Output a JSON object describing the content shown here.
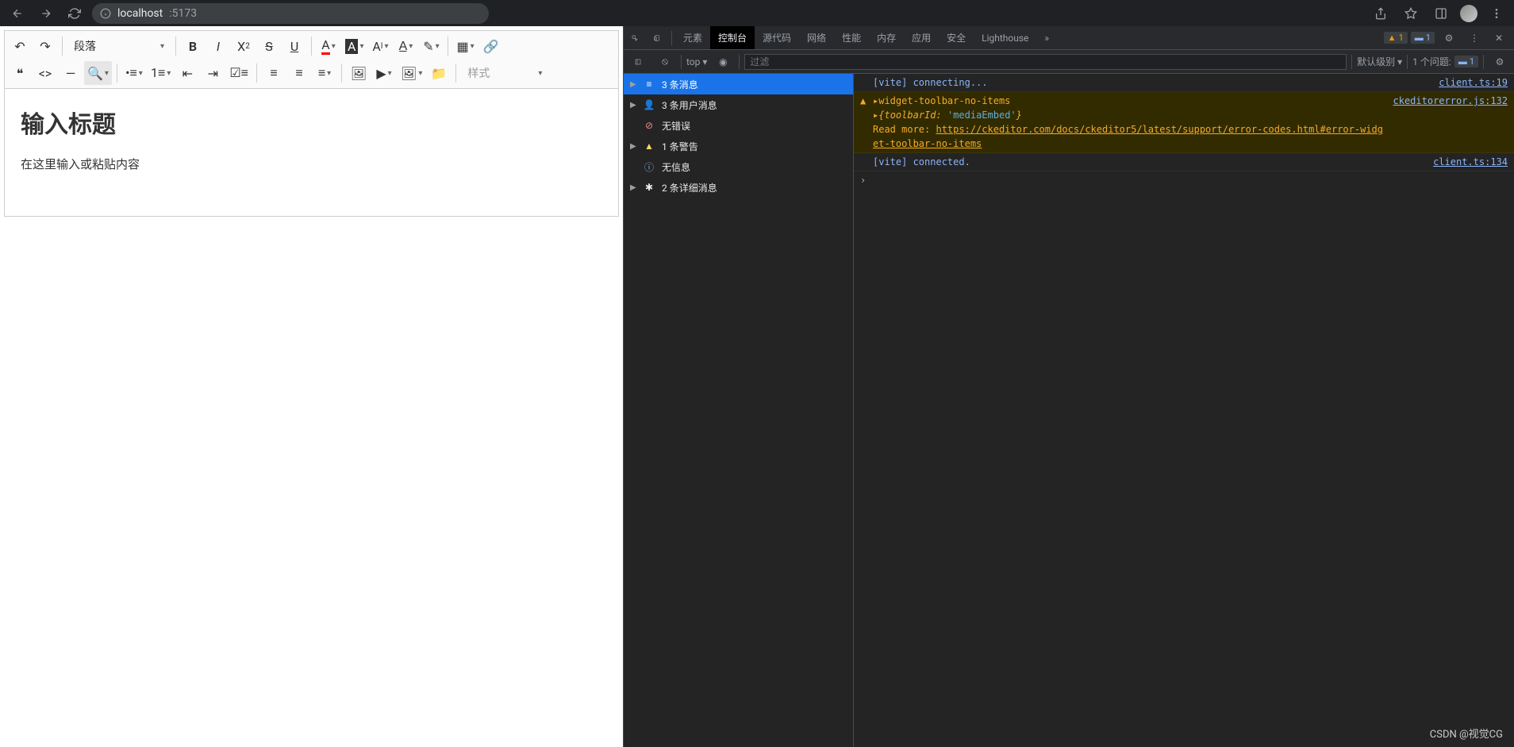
{
  "browser": {
    "url_host": "localhost",
    "url_port": ":5173"
  },
  "editor": {
    "heading_label": "段落",
    "style_label": "样式",
    "title_placeholder": "输入标题",
    "body_placeholder": "在这里输入或粘贴内容"
  },
  "devtools": {
    "tabs": {
      "elements": "元素",
      "console": "控制台",
      "sources": "源代码",
      "network": "网络",
      "performance": "性能",
      "memory": "内存",
      "application": "应用",
      "security": "安全",
      "lighthouse": "Lighthouse"
    },
    "badge_warn": "1",
    "badge_info": "1",
    "filter": {
      "context": "top",
      "placeholder": "过滤",
      "level": "默认级别",
      "issues_label": "1 个问题:",
      "issues_count": "1"
    },
    "sidebar": {
      "messages": "3 条消息",
      "user_messages": "3 条用户消息",
      "no_errors": "无错误",
      "warnings": "1 条警告",
      "no_info": "无信息",
      "verbose": "2 条详细消息"
    },
    "logs": {
      "connecting": "[vite] connecting...",
      "connecting_src": "client.ts:19",
      "warn_title": "widget-toolbar-no-items",
      "warn_src": "ckeditorerror.js:132",
      "warn_obj_key": "toolbarId:",
      "warn_obj_val": "'mediaEmbed'",
      "read_more": "Read more:",
      "warn_link": "https://ckeditor.com/docs/ckeditor5/latest/support/error-codes.html#error-widget-toolbar-no-items",
      "connected": "[vite] connected.",
      "connected_src": "client.ts:134"
    }
  },
  "watermark": "CSDN @视觉CG"
}
